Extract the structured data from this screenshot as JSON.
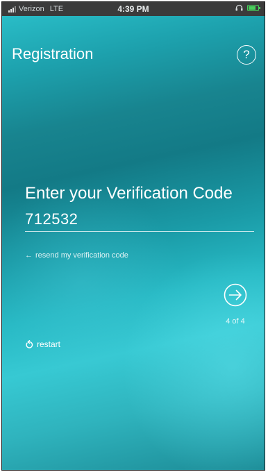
{
  "status_bar": {
    "carrier": "Verizon",
    "network": "LTE",
    "time": "4:39 PM",
    "icons": [
      "signal-bars-icon",
      "headphones-icon",
      "battery-charging-icon"
    ],
    "battery_color": "#47d05b",
    "battery_level": 0.8
  },
  "header": {
    "title": "Registration",
    "help_label": "?"
  },
  "form": {
    "heading": "Enter your Verification Code",
    "code_value": "712532",
    "resend_arrow": "←",
    "resend_label": "resend my verification code",
    "next_icon": "arrow-right-circle-icon",
    "step_label": "4 of 4",
    "restart_label": "restart",
    "restart_icon": "restart-icon"
  },
  "colors": {
    "background_dark": "#137a86",
    "background_light": "#37c9d3",
    "text": "#ffffff"
  }
}
